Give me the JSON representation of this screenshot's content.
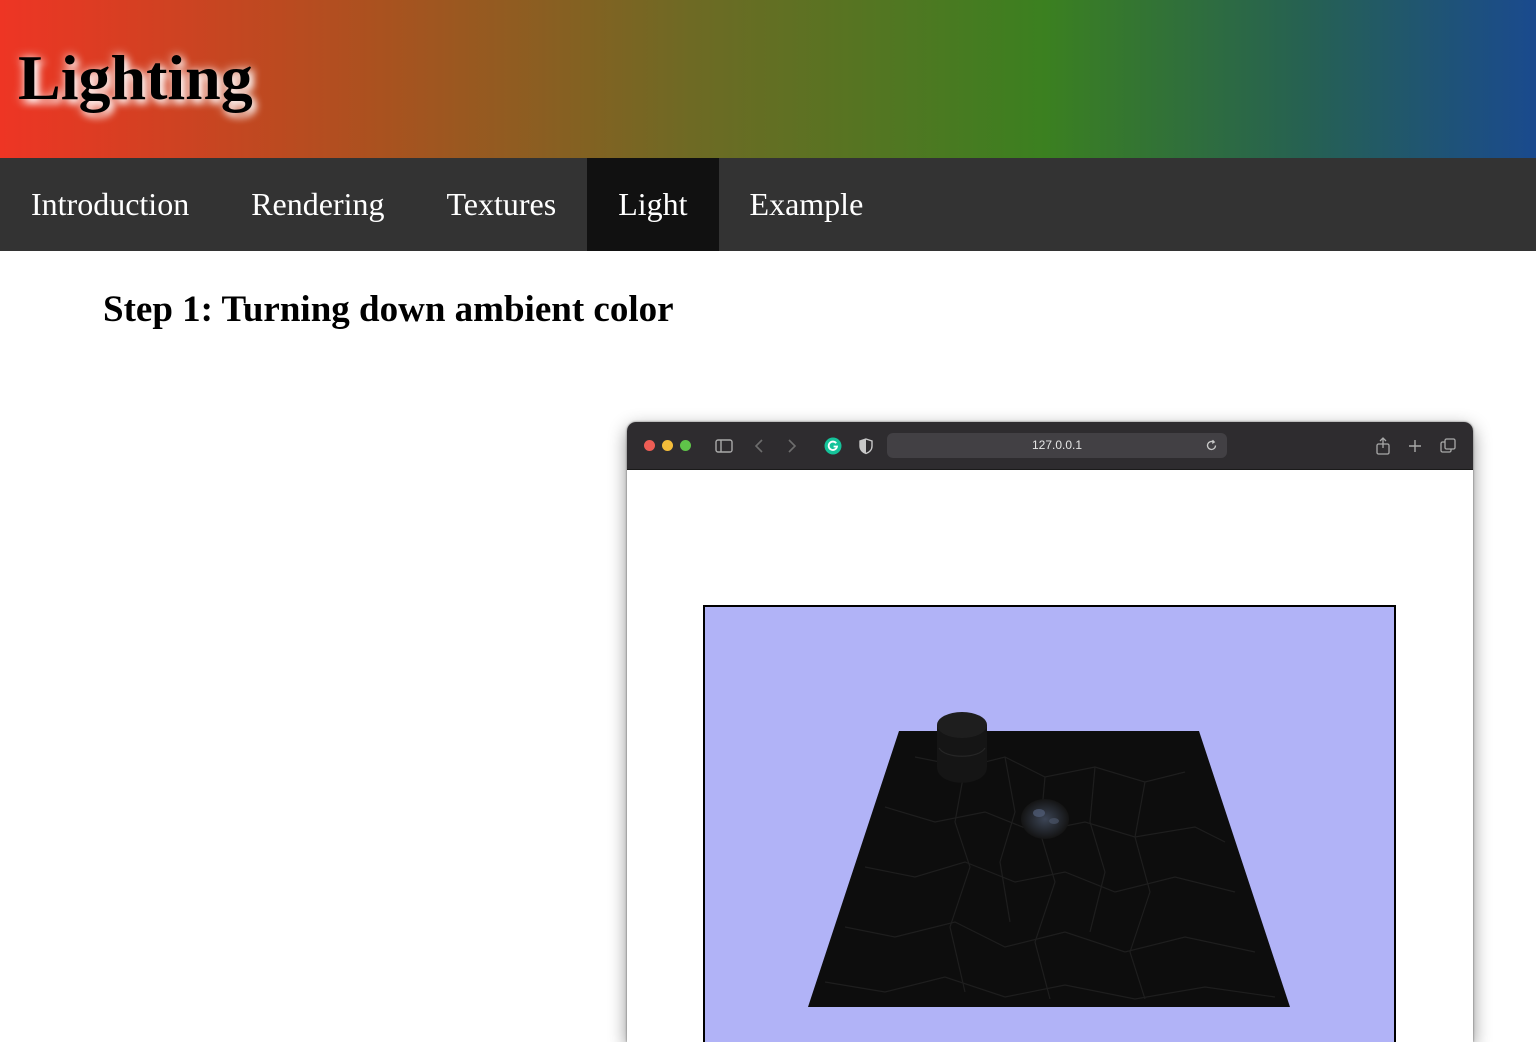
{
  "header": {
    "title": "Lighting"
  },
  "nav": {
    "items": [
      {
        "label": "Introduction"
      },
      {
        "label": "Rendering"
      },
      {
        "label": "Textures"
      },
      {
        "label": "Light"
      },
      {
        "label": "Example"
      }
    ],
    "active": "Light"
  },
  "content": {
    "step_title": "Step 1: Turning down ambient color",
    "screenshot": {
      "address": "127.0.0.1",
      "icons": [
        "close-dot",
        "minimize-dot",
        "zoom-dot",
        "sidebar-icon",
        "back-icon",
        "forward-icon",
        "grammarly-icon",
        "privacy-shield-icon",
        "reload-icon",
        "share-icon",
        "new-tab-icon",
        "tab-overview-icon"
      ],
      "scene_background": "#b1b3f7",
      "ground_color": "#0d0d0d"
    }
  },
  "colors": {
    "nav_bg": "#333333",
    "nav_active_bg": "#111111",
    "nav_text": "#ffffff",
    "gradient": [
      "#ee3524",
      "#a9521f",
      "#6e6a24",
      "#3b8020",
      "#266152",
      "#1a4a8e"
    ]
  }
}
